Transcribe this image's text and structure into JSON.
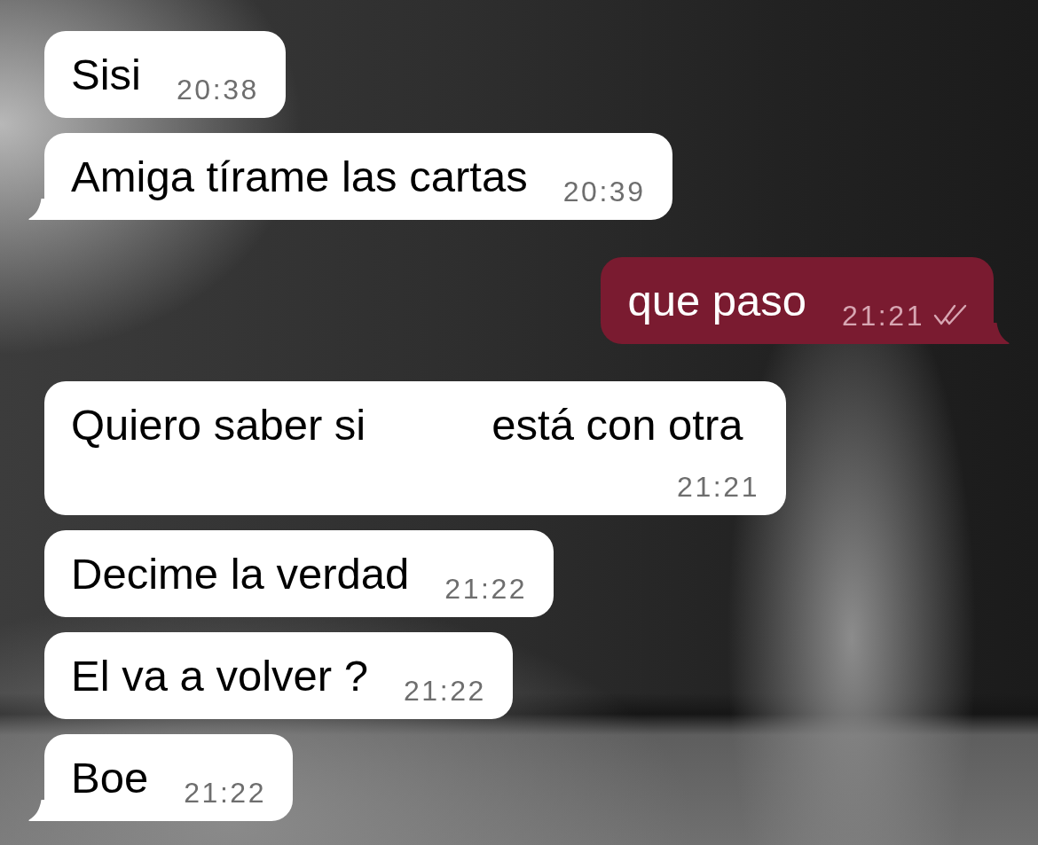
{
  "messages": [
    {
      "kind": "incoming",
      "tail": false,
      "parts": [
        "Sisi"
      ],
      "time": "20:38"
    },
    {
      "kind": "incoming",
      "tail": true,
      "parts": [
        "Amiga tírame las cartas"
      ],
      "time": "20:39"
    },
    {
      "kind": "outgoing",
      "tail": true,
      "parts": [
        "que paso"
      ],
      "time": "21:21",
      "read": true
    },
    {
      "kind": "incoming",
      "tail": false,
      "parts": [
        "Quiero saber si",
        "está con otra"
      ],
      "time": "21:21"
    },
    {
      "kind": "incoming",
      "tail": false,
      "parts": [
        "Decime la verdad"
      ],
      "time": "21:22"
    },
    {
      "kind": "incoming",
      "tail": false,
      "parts": [
        "El va a volver ?"
      ],
      "time": "21:22"
    },
    {
      "kind": "incoming",
      "tail": true,
      "parts": [
        "Boe"
      ],
      "time": "21:22"
    }
  ]
}
